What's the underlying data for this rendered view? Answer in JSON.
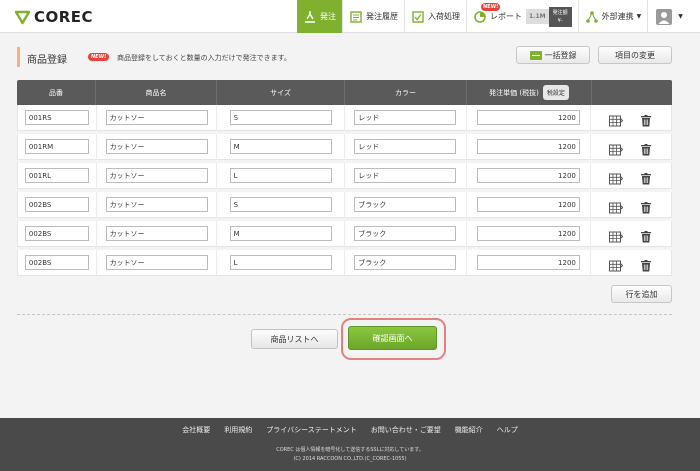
{
  "brand": {
    "name": "COREC"
  },
  "nav": {
    "items": [
      {
        "label": "発注",
        "icon": "order-icon",
        "active": true
      },
      {
        "label": "発注履歴",
        "icon": "history-icon"
      },
      {
        "label": "入荷処理",
        "icon": "receive-icon"
      },
      {
        "label": "レポート",
        "icon": "report-icon",
        "badge": "NEW!"
      },
      {
        "label": "外部連携",
        "icon": "share-icon"
      }
    ],
    "counter": {
      "value": "1.1M",
      "label_top": "発注額",
      "label_bottom": "¥-"
    }
  },
  "page": {
    "title": "商品登録",
    "new_badge": "NEW!",
    "description": "商品登録をしておくと数量の入力だけで発注できます。",
    "bulk_button": "一括登録",
    "columns_button": "項目の変更"
  },
  "table": {
    "headers": [
      "品番",
      "商品名",
      "サイズ",
      "カラー",
      "発注単価 (税抜)"
    ],
    "tax_button": "税設定",
    "rows": [
      {
        "code": "001RS",
        "name": "カットソー",
        "size": "S",
        "color": "レッド",
        "price": "1200"
      },
      {
        "code": "001RM",
        "name": "カットソー",
        "size": "M",
        "color": "レッド",
        "price": "1200"
      },
      {
        "code": "001RL",
        "name": "カットソー",
        "size": "L",
        "color": "レッド",
        "price": "1200"
      },
      {
        "code": "002BS",
        "name": "カットソー",
        "size": "S",
        "color": "ブラック",
        "price": "1200"
      },
      {
        "code": "002BS",
        "name": "カットソー",
        "size": "M",
        "color": "ブラック",
        "price": "1200"
      },
      {
        "code": "002BS",
        "name": "カットソー",
        "size": "L",
        "color": "ブラック",
        "price": "1200"
      }
    ]
  },
  "actions": {
    "add_row": "行を追加",
    "product_list": "商品リストへ",
    "confirm": "確認画面へ"
  },
  "footer": {
    "links": [
      "会社概要",
      "利用規約",
      "プライバシーステートメント",
      "お問い合わせ・ご要望",
      "機能紹介",
      "ヘルプ"
    ],
    "note": "COREC は個人情報を暗号化して送信するSSLに対応しています。",
    "copyright": "(C) 2014 RACCOON CO.,LTD.(C_COREC-1055)"
  }
}
